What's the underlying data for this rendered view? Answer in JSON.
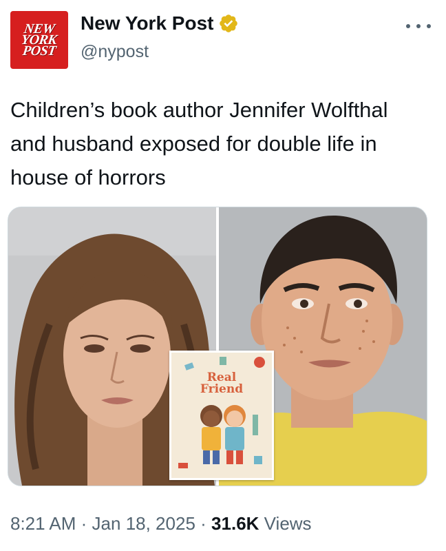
{
  "account": {
    "display_name": "New York Post",
    "handle": "@nypost",
    "logo_lines": [
      "NEW",
      "YORK",
      "POST"
    ],
    "verified_icon": "gold-verified-badge-icon",
    "brand_color": "#d61f1f"
  },
  "tweet": {
    "text": "Children’s book author Jennifer Wolfthal and husband exposed for double life in house of horrors",
    "time": "8:21 AM",
    "separator": "·",
    "date": "Jan 18, 2025",
    "views_count": "31.6K",
    "views_label": "Views"
  },
  "media": {
    "book_title_line1": "Real",
    "book_title_line2": "Friend"
  },
  "icons": {
    "more": "more-horizontal-icon",
    "verified": "verified-badge-icon"
  },
  "colors": {
    "text_primary": "#0f1419",
    "text_secondary": "#536471",
    "verified_gold": "#e2b719",
    "border": "#cfd9de"
  }
}
